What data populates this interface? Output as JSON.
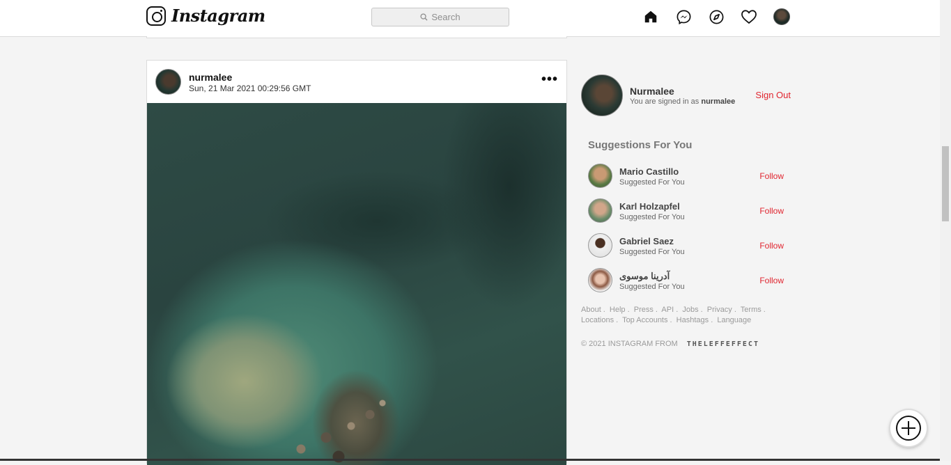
{
  "header": {
    "logo_text": "Instagram",
    "search_placeholder": "Search",
    "nav_icons": [
      "home-icon",
      "messenger-icon",
      "explore-compass-icon",
      "heart-icon",
      "profile-avatar"
    ]
  },
  "post": {
    "username": "nurmalee",
    "timestamp": "Sun, 21 Mar 2021 00:29:56 GMT",
    "more_label": "•••"
  },
  "sidebar": {
    "user": {
      "display_name": "Nurmalee",
      "signed_in_prefix": "You are signed in as",
      "username": "nurmalee",
      "sign_out_label": "Sign Out"
    },
    "suggestions_title": "Suggestions For You",
    "suggestions": [
      {
        "name": "Mario Castillo",
        "subtitle": "Suggested For You",
        "action": "Follow"
      },
      {
        "name": "Karl Holzapfel",
        "subtitle": "Suggested For You",
        "action": "Follow"
      },
      {
        "name": "Gabriel Saez",
        "subtitle": "Suggested For You",
        "action": "Follow"
      },
      {
        "name": "آدرینا موسوی",
        "subtitle": "Suggested For You",
        "action": "Follow"
      }
    ],
    "footer_links": [
      "About .",
      "Help .",
      "Press .",
      "API .",
      "Jobs .",
      "Privacy .",
      "Terms .",
      "Locations .",
      "Top Accounts .",
      "Hashtags .",
      "Language"
    ],
    "copyright": "© 2021 INSTAGRAM FROM",
    "brand": "THELEFFEFFECT"
  },
  "colors": {
    "accent_red": "#e0242e",
    "background": "#f4f4f4"
  }
}
